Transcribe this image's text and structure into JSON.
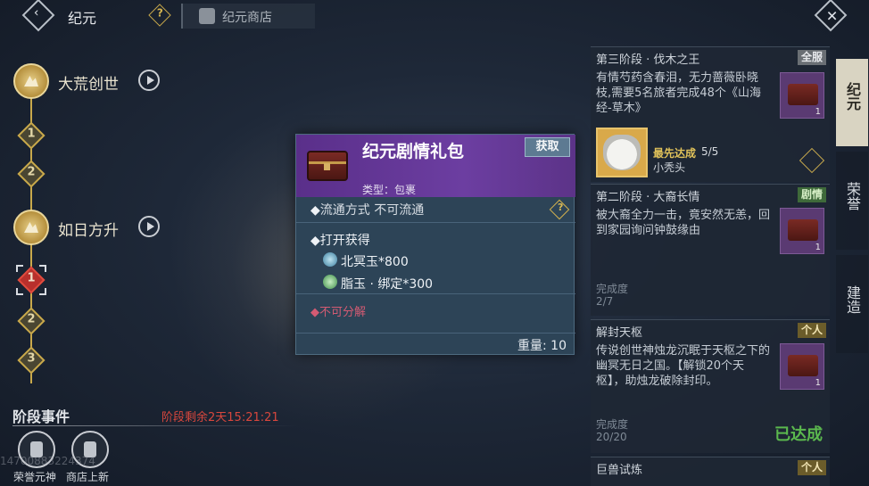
{
  "topbar": {
    "title": "纪元",
    "help_icon": "?",
    "shop_tab": "纪元商店",
    "back_icon": "‹",
    "close_icon": "✕"
  },
  "timeline": {
    "eras": [
      {
        "name": "大荒创世"
      },
      {
        "name": "如日方升"
      }
    ],
    "nodes": [
      "1",
      "2",
      "1",
      "2",
      "3"
    ]
  },
  "stage": {
    "title": "阶段事件",
    "time_left": "阶段剩余2天15:21:21",
    "buttons": [
      {
        "label": "荣誉元神"
      },
      {
        "label": "商店上新"
      }
    ],
    "uid": "14700883224374"
  },
  "popup": {
    "title": "纪元剧情礼包",
    "get_button": "获取",
    "type": "类型：包裹",
    "circulation": "流通方式   不可流通",
    "open_title": "打开获得",
    "items": [
      {
        "name": "北冥玉*800"
      },
      {
        "name": "脂玉 · 绑定*300"
      }
    ],
    "no_decompose": "不可分解",
    "weight": "重量: 10"
  },
  "quests": [
    {
      "title": "第三阶段 · 伐木之王",
      "tag": "全服",
      "desc": "有情芍药含春泪，无力蔷薇卧晓枝,需要5名旅者完成48个《山海经-草木》",
      "reward_count": "1",
      "first_label": "最先达成",
      "first_count": "5/5",
      "first_name": "小秃头"
    },
    {
      "title": "第二阶段 · 大裔长情",
      "tag": "剧情",
      "desc": "被大裔全力一击，竟安然无恙，回到家园询问钟鼓缘由",
      "progress_label": "完成度",
      "progress": "2/7",
      "reward_count": "1"
    },
    {
      "title": "解封天枢",
      "tag": "个人",
      "desc": "传说创世神烛龙沉眠于天枢之下的幽冥无日之国。【解锁20个天枢】，助烛龙破除封印。",
      "progress_label": "完成度",
      "progress": "20/20",
      "done": "已达成",
      "reward_count": "1"
    },
    {
      "title": "巨兽试炼",
      "tag": "个人"
    }
  ],
  "side_tabs": [
    "纪元",
    "荣誉",
    "建造"
  ],
  "colors": {
    "accent_gold": "#c9a94b",
    "popup_purple": "#6c3ea1",
    "warn_red": "#d8473d",
    "done_green": "#5bb84e"
  }
}
